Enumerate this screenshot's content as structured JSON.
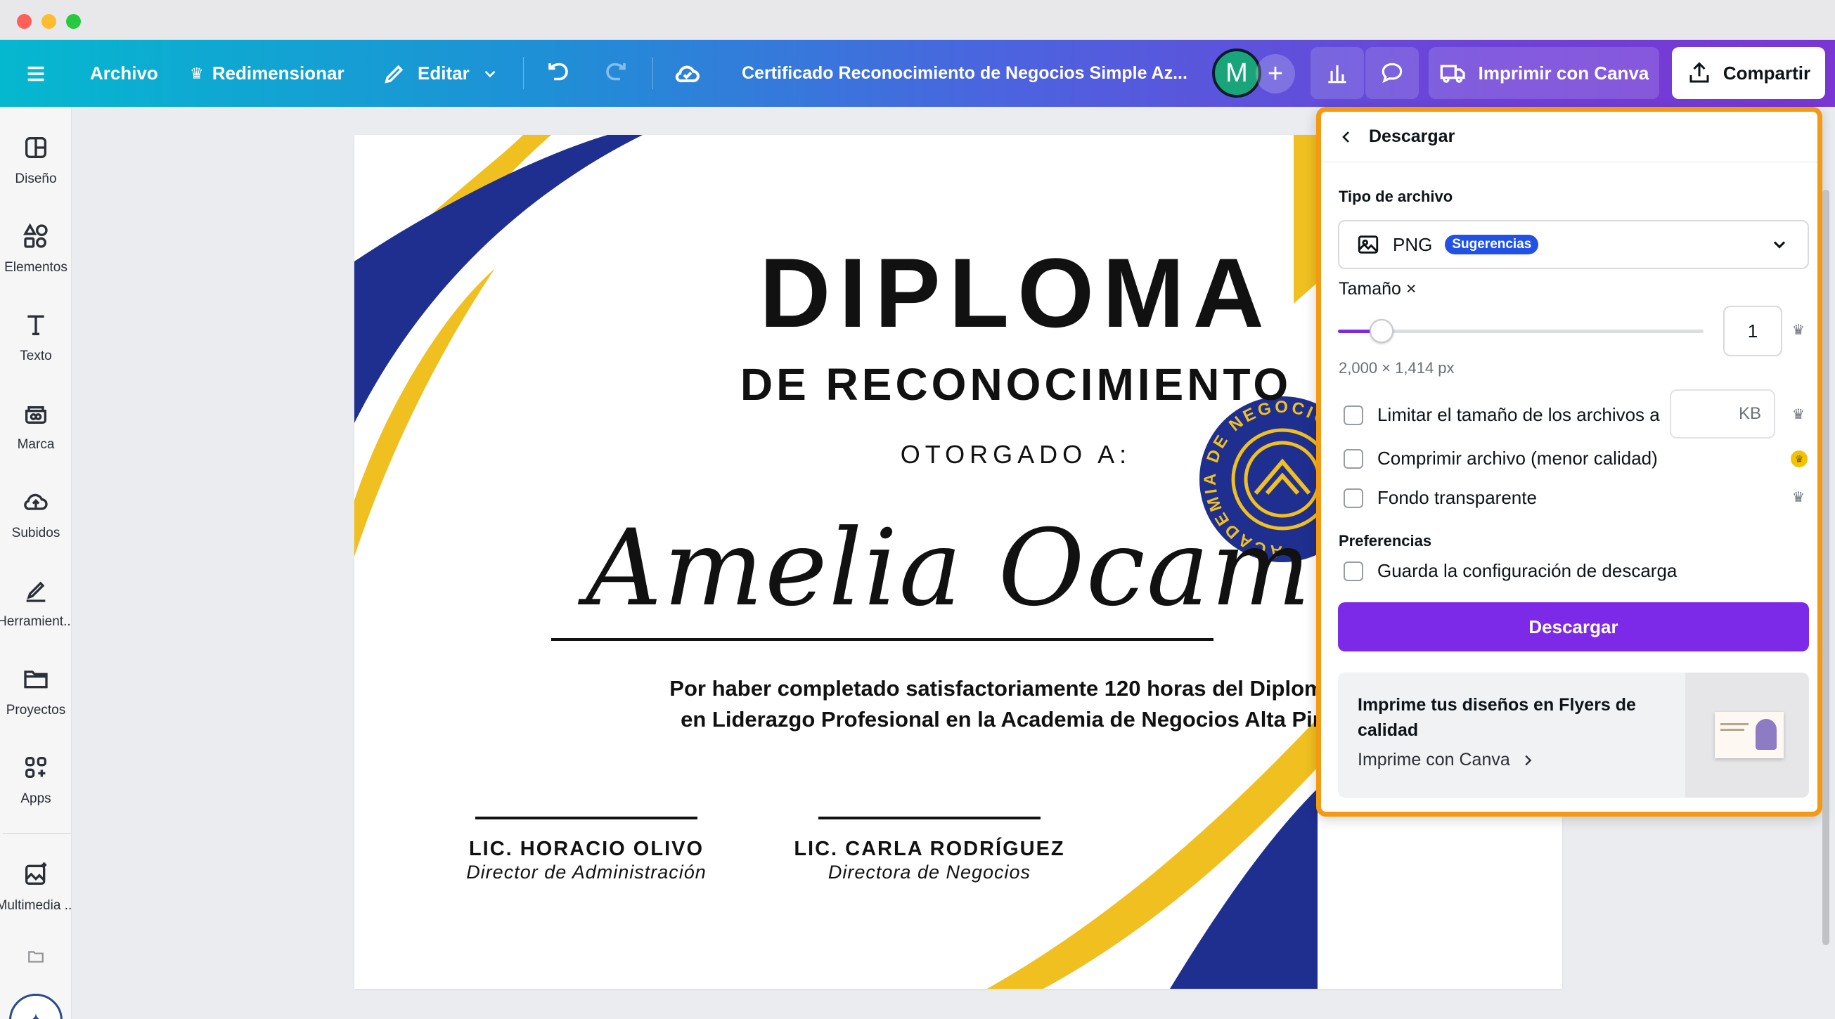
{
  "toolbar": {
    "file": "Archivo",
    "resize": "Redimensionar",
    "edit": "Editar",
    "doc_title": "Certificado Reconocimiento de Negocios Simple Az...",
    "avatar_initial": "M",
    "print": "Imprimir con Canva",
    "share": "Compartir"
  },
  "sidebar": {
    "items": [
      {
        "label": "Diseño"
      },
      {
        "label": "Elementos"
      },
      {
        "label": "Texto"
      },
      {
        "label": "Marca"
      },
      {
        "label": "Subidos"
      },
      {
        "label": "Herramient..."
      },
      {
        "label": "Proyectos"
      },
      {
        "label": "Apps"
      },
      {
        "label": "Multimedia ..."
      }
    ]
  },
  "certificate": {
    "title": "DIPLOMA",
    "subtitle": "DE RECONOCIMIENTO",
    "awarded_to": "OTORGADO A:",
    "recipient": "Amelia Ocampo",
    "body_line1": "Por haber completado satisfactoriamente 120 horas del Diplomado",
    "body_line2": "en Liderazgo Profesional en la Academia de Negocios Alta Pinta.",
    "seal_text": "ACADEMIA DE NEGOCIOS ALTA",
    "signers": [
      {
        "name": "LIC. HORACIO OLIVO",
        "role": "Director de Administración"
      },
      {
        "name": "LIC. CARLA RODRÍGUEZ",
        "role": "Directora de Negocios"
      }
    ],
    "colors": {
      "blue": "#1f2f8f",
      "yellow": "#f0c020"
    }
  },
  "download_panel": {
    "header": "Descargar",
    "file_type_label": "Tipo de archivo",
    "file_type": "PNG",
    "file_type_badge": "Sugerencias",
    "size_label": "Tamaño ×",
    "size_value": "1",
    "size_slider_fraction": 0.12,
    "dimensions": "2,000 × 1,414 px",
    "limit_label": "Limitar el tamaño de los archivos a",
    "limit_unit": "KB",
    "compress_label": "Comprimir archivo (menor calidad)",
    "transparent_label": "Fondo transparente",
    "prefs_label": "Preferencias",
    "save_settings_label": "Guarda la configuración de descarga",
    "download_button": "Descargar",
    "promo_title": "Imprime tus diseños en Flyers de calidad",
    "promo_link": "Imprime con Canva"
  },
  "accent_colors": {
    "download_purple": "#7d2ae8",
    "highlight_orange": "#f39a12",
    "badge_blue": "#2152e5"
  }
}
